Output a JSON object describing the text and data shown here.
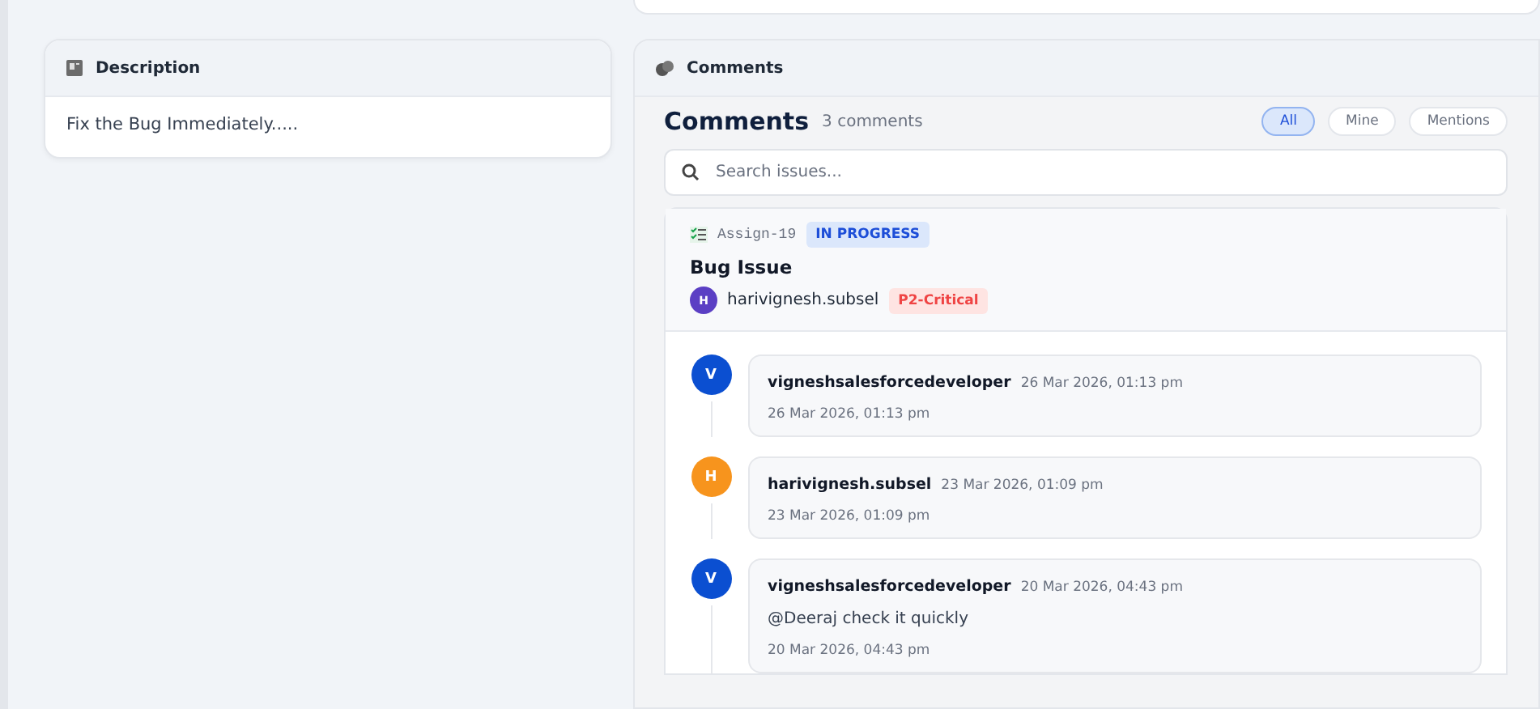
{
  "description": {
    "title": "Description",
    "text": "Fix the Bug Immediately....."
  },
  "comments_panel": {
    "title": "Comments",
    "heading": "Comments",
    "count": "3 comments",
    "filters": [
      {
        "label": "All",
        "selected": true
      },
      {
        "label": "Mine",
        "selected": false
      },
      {
        "label": "Mentions",
        "selected": false
      }
    ],
    "search": {
      "placeholder": "Search issues..."
    },
    "issue": {
      "key": "Assign-19",
      "status": "IN PROGRESS",
      "title": "Bug Issue",
      "assignee_initial": "H",
      "assignee": "harivignesh.subsel",
      "priority": "P2-Critical"
    },
    "comments": [
      {
        "initial": "V",
        "color": "#0b4fd1",
        "author": "vigneshsalesforcedeveloper",
        "time": "26 Mar 2026, 01:13 pm",
        "footer": "26 Mar 2026, 01:13 pm"
      },
      {
        "initial": "H",
        "color": "#f7941d",
        "author": "harivignesh.subsel",
        "time": "23 Mar 2026, 01:09 pm",
        "footer": "23 Mar 2026, 01:09 pm"
      },
      {
        "initial": "V",
        "color": "#0b4fd1",
        "author": "vigneshsalesforcedeveloper",
        "time": "20 Mar 2026, 04:43 pm",
        "body": "@Deeraj check it quickly",
        "footer": "20 Mar 2026, 04:43 pm"
      }
    ]
  }
}
